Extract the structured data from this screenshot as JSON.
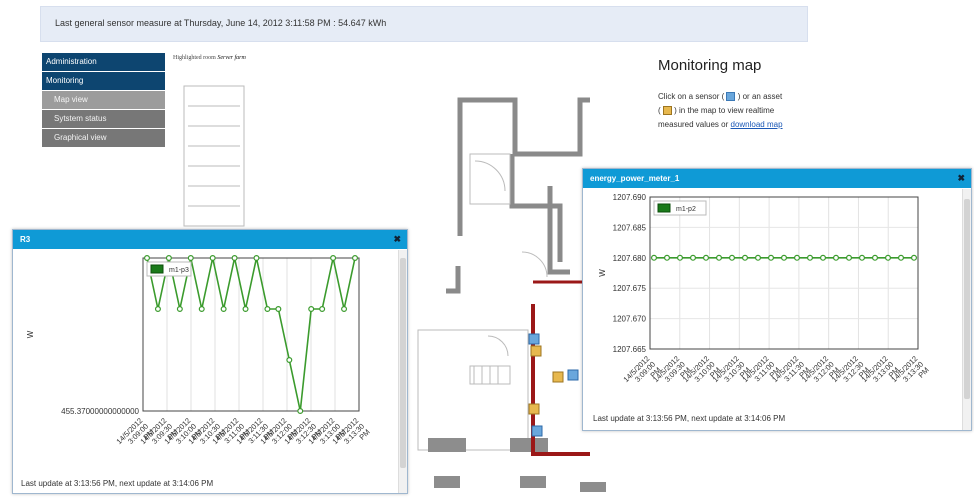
{
  "banner": {
    "text": "Last general sensor measure at Thursday, June 14, 2012 3:11:58 PM : 54.647 kWh"
  },
  "sidebar": {
    "items": [
      {
        "label": "Administration",
        "level": "top",
        "active": false
      },
      {
        "label": "Monitoring",
        "level": "top",
        "active": false
      },
      {
        "label": "Map view",
        "level": "sub",
        "active": true
      },
      {
        "label": "Sytstem status",
        "level": "sub",
        "active": false
      },
      {
        "label": "Graphical view",
        "level": "sub",
        "active": false
      }
    ]
  },
  "map": {
    "highlight_label": "Highlighted room",
    "highlight_room": "Server farm"
  },
  "side_panel": {
    "title": "Monitoring map",
    "text_1": "Click on a sensor (",
    "text_2": ") or an asset",
    "text_3": "(",
    "text_4": ") in the map to view realtime measured values or",
    "link": "download map"
  },
  "popups": [
    {
      "title": "R3",
      "close": "✖",
      "footer": "Last update at 3:13:56 PM, next update at 3:14:06 PM",
      "chart_data": {
        "type": "line",
        "ylabel": "W",
        "y_tick_labels": [
          "455.37000000000000"
        ],
        "legend": [
          "m1-p3"
        ],
        "x_tick_labels": [
          "14/5/2012 3:09:00 PM",
          "14/5/2012 3:09:30 PM",
          "14/5/2012 3:10:00 PM",
          "14/5/2012 3:10:30 PM",
          "14/5/2012 3:11:00 PM",
          "14/5/2012 3:11:30 PM",
          "14/5/2012 3:12:00 PM",
          "14/5/2012 3:12:30 PM",
          "14/5/2012 3:13:00 PM",
          "14/5/2012 3:13:30 PM"
        ],
        "series": [
          {
            "name": "m1-p3",
            "values": [
              455.4,
              455.39,
              455.4,
              455.39,
              455.4,
              455.39,
              455.4,
              455.39,
              455.4,
              455.39,
              455.4,
              455.39,
              455.39,
              455.38,
              455.37,
              455.39,
              455.39,
              455.4,
              455.39,
              455.4
            ]
          }
        ],
        "ylim": [
          455.37,
          455.4
        ],
        "grid": true,
        "legend_position": "top-left",
        "color": "#3b9b2d"
      }
    },
    {
      "title": "energy_power_meter_1",
      "close": "✖",
      "footer": "Last update at 3:13:56 PM, next update at 3:14:06 PM",
      "chart_data": {
        "type": "line",
        "ylabel": "W",
        "y_tick_labels": [
          "1207.665",
          "1207.670",
          "1207.675",
          "1207.680",
          "1207.685",
          "1207.690"
        ],
        "ylim": [
          1207.665,
          1207.69
        ],
        "legend": [
          "m1-p2"
        ],
        "x_tick_labels": [
          "14/5/2012 3:09:00 PM",
          "14/5/2012 3:09:30 PM",
          "14/5/2012 3:10:00 PM",
          "14/5/2012 3:10:30 PM",
          "14/5/2012 3:11:00 PM",
          "14/5/2012 3:11:30 PM",
          "14/5/2012 3:12:00 PM",
          "14/5/2012 3:12:30 PM",
          "14/5/2012 3:13:00 PM",
          "14/5/2012 3:13:30 PM"
        ],
        "series": [
          {
            "name": "m1-p2",
            "values": [
              1207.68,
              1207.68,
              1207.68,
              1207.68,
              1207.68,
              1207.68,
              1207.68,
              1207.68,
              1207.68,
              1207.68,
              1207.68,
              1207.68,
              1207.68,
              1207.68,
              1207.68,
              1207.68,
              1207.68,
              1207.68,
              1207.68,
              1207.68,
              1207.68
            ]
          }
        ],
        "grid": true,
        "legend_position": "top-left",
        "color": "#3b9b2d"
      }
    }
  ]
}
